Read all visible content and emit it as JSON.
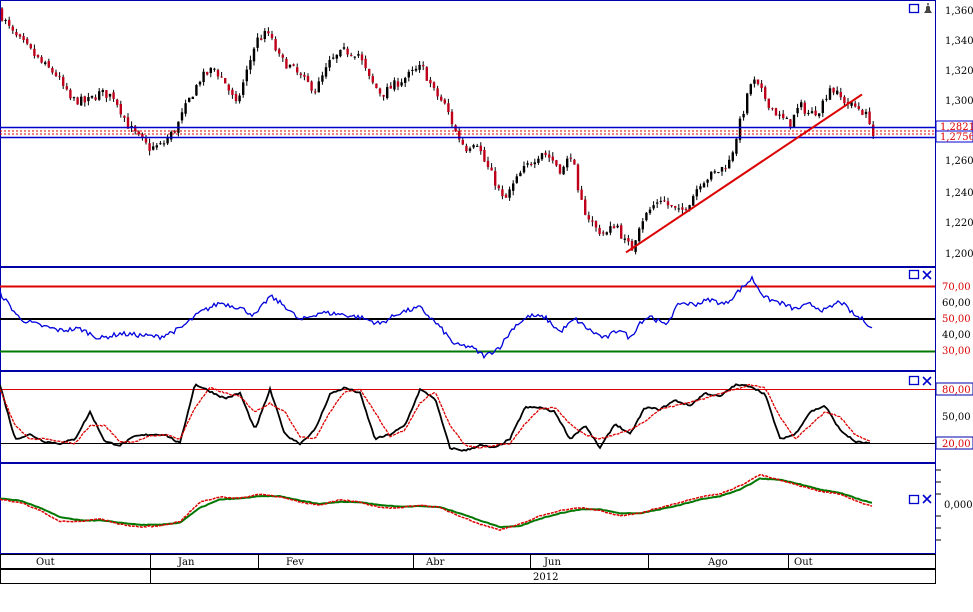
{
  "colors": {
    "bull": "#000000",
    "bear": "#c0001a",
    "blue_line": "#0000cc",
    "red_line": "#dd0000",
    "green_line": "#007700",
    "black_line": "#000000",
    "dotted_red": "#dd0000",
    "frame": "#0000aa",
    "grid_text": "#000000"
  },
  "panel_icons": {
    "window": "window-icon",
    "close": "close-icon",
    "bell": "bell-icon"
  },
  "price_panel": {
    "y_ticks": [
      "1,3600",
      "1,3400",
      "1,3200",
      "1,3000",
      "1,2600",
      "1,2400",
      "1,2200",
      "1,2000"
    ],
    "badge_upper": "1,28213",
    "badge_lower": "1,27561"
  },
  "rsi_panel": {
    "labels": [
      "70,00",
      "60,00",
      "50,00",
      "40,00",
      "30,00"
    ]
  },
  "stoch_panel": {
    "labels": [
      "80,00",
      "50,00",
      "20,00"
    ]
  },
  "macd_panel": {
    "labels": [
      "0,0000"
    ]
  },
  "time_axis": {
    "months": [
      "Out",
      "Jan",
      "Fev",
      "Abr",
      "Jun",
      "Ago",
      "Out"
    ],
    "year": "2012"
  },
  "chart_data": [
    {
      "type": "candlestick",
      "ylim": [
        1.195,
        1.365
      ],
      "x_tick_labels": [
        "Out",
        "Jan",
        "Fev",
        "Abr",
        "Jun",
        "Ago",
        "Out"
      ],
      "y_tick_labels": [
        "1,3600",
        "1,3400",
        "1,3200",
        "1,3000",
        "1,2600",
        "1,2400",
        "1,2200",
        "1,2000"
      ],
      "close_anchors": [
        [
          0,
          1.358
        ],
        [
          12,
          1.345
        ],
        [
          28,
          1.335
        ],
        [
          42,
          1.325
        ],
        [
          56,
          1.318
        ],
        [
          70,
          1.302
        ],
        [
          86,
          1.3
        ],
        [
          100,
          1.306
        ],
        [
          114,
          1.304
        ],
        [
          128,
          1.285
        ],
        [
          140,
          1.276
        ],
        [
          150,
          1.27
        ],
        [
          162,
          1.272
        ],
        [
          176,
          1.283
        ],
        [
          188,
          1.3
        ],
        [
          200,
          1.315
        ],
        [
          214,
          1.322
        ],
        [
          226,
          1.312
        ],
        [
          236,
          1.298
        ],
        [
          246,
          1.318
        ],
        [
          256,
          1.34
        ],
        [
          268,
          1.345
        ],
        [
          280,
          1.328
        ],
        [
          292,
          1.322
        ],
        [
          304,
          1.314
        ],
        [
          316,
          1.308
        ],
        [
          330,
          1.326
        ],
        [
          344,
          1.333
        ],
        [
          358,
          1.332
        ],
        [
          370,
          1.314
        ],
        [
          382,
          1.305
        ],
        [
          396,
          1.312
        ],
        [
          410,
          1.318
        ],
        [
          422,
          1.323
        ],
        [
          434,
          1.307
        ],
        [
          446,
          1.297
        ],
        [
          456,
          1.28
        ],
        [
          466,
          1.27
        ],
        [
          476,
          1.276
        ],
        [
          484,
          1.262
        ],
        [
          494,
          1.25
        ],
        [
          504,
          1.235
        ],
        [
          512,
          1.245
        ],
        [
          522,
          1.255
        ],
        [
          532,
          1.262
        ],
        [
          542,
          1.268
        ],
        [
          552,
          1.263
        ],
        [
          562,
          1.255
        ],
        [
          572,
          1.268
        ],
        [
          578,
          1.24
        ],
        [
          586,
          1.228
        ],
        [
          596,
          1.218
        ],
        [
          606,
          1.214
        ],
        [
          616,
          1.222
        ],
        [
          624,
          1.21
        ],
        [
          632,
          1.205
        ],
        [
          640,
          1.222
        ],
        [
          650,
          1.23
        ],
        [
          660,
          1.238
        ],
        [
          670,
          1.232
        ],
        [
          680,
          1.228
        ],
        [
          690,
          1.236
        ],
        [
          700,
          1.248
        ],
        [
          710,
          1.252
        ],
        [
          720,
          1.256
        ],
        [
          730,
          1.262
        ],
        [
          738,
          1.282
        ],
        [
          746,
          1.3
        ],
        [
          752,
          1.315
        ],
        [
          760,
          1.308
        ],
        [
          770,
          1.298
        ],
        [
          780,
          1.29
        ],
        [
          790,
          1.286
        ],
        [
          800,
          1.298
        ],
        [
          810,
          1.292
        ],
        [
          820,
          1.296
        ],
        [
          830,
          1.31
        ],
        [
          840,
          1.303
        ],
        [
          850,
          1.298
        ],
        [
          860,
          1.296
        ],
        [
          870,
          1.288
        ],
        [
          874,
          1.276
        ]
      ],
      "horizontal_levels": [
        1.28213,
        1.27561
      ],
      "trendlines": [
        {
          "from": [
            626,
            1.2025
          ],
          "to": [
            862,
            1.305
          ]
        }
      ]
    },
    {
      "type": "line",
      "ylim": [
        20,
        80
      ],
      "reference_levels": [
        70,
        50,
        30
      ],
      "series": [
        {
          "values_anchor_x": [
            0,
            20,
            40,
            60,
            80,
            100,
            120,
            140,
            160,
            180,
            200,
            220,
            240,
            255,
            270,
            285,
            300,
            320,
            340,
            360,
            380,
            400,
            420,
            440,
            455,
            470,
            485,
            500,
            515,
            530,
            545,
            560,
            575,
            590,
            605,
            620,
            630,
            640,
            650,
            665,
            680,
            695,
            710,
            725,
            740,
            752,
            765,
            780,
            795,
            810,
            825,
            840,
            855,
            865,
            872
          ],
          "values": [
            66,
            50,
            46,
            43,
            44,
            38,
            41,
            40,
            39,
            44,
            54,
            60,
            57,
            52,
            64,
            58,
            49,
            54,
            53,
            51,
            47,
            54,
            57,
            45,
            34,
            33,
            27,
            33,
            46,
            52,
            51,
            42,
            50,
            43,
            38,
            44,
            38,
            48,
            52,
            46,
            60,
            59,
            62,
            59,
            68,
            75,
            63,
            60,
            56,
            59,
            55,
            61,
            52,
            49,
            44
          ]
        }
      ]
    },
    {
      "type": "line",
      "ylim": [
        0,
        100
      ],
      "reference_levels": [
        80,
        20
      ],
      "series": [
        {
          "name": "",
          "values_anchor_x": [
            0,
            15,
            30,
            45,
            60,
            75,
            90,
            105,
            120,
            135,
            150,
            165,
            180,
            195,
            210,
            225,
            240,
            255,
            270,
            285,
            300,
            315,
            330,
            345,
            360,
            375,
            390,
            405,
            420,
            435,
            450,
            465,
            480,
            495,
            510,
            525,
            540,
            555,
            570,
            585,
            600,
            615,
            630,
            645,
            660,
            675,
            690,
            705,
            720,
            735,
            750,
            765,
            780,
            795,
            810,
            825,
            840,
            855,
            870
          ],
          "values": [
            85,
            25,
            30,
            22,
            20,
            25,
            55,
            22,
            18,
            28,
            30,
            30,
            20,
            86,
            78,
            70,
            76,
            35,
            80,
            30,
            20,
            35,
            75,
            82,
            76,
            25,
            30,
            40,
            80,
            70,
            15,
            12,
            18,
            15,
            25,
            60,
            60,
            55,
            25,
            40,
            15,
            42,
            30,
            60,
            58,
            68,
            62,
            76,
            72,
            85,
            84,
            75,
            25,
            30,
            55,
            62,
            35,
            22,
            20
          ]
        },
        {
          "name": "",
          "values_anchor_x": [
            0,
            15,
            30,
            45,
            60,
            75,
            90,
            105,
            120,
            135,
            150,
            165,
            180,
            195,
            210,
            225,
            240,
            255,
            270,
            285,
            300,
            315,
            330,
            345,
            360,
            375,
            390,
            405,
            420,
            435,
            450,
            465,
            480,
            495,
            510,
            525,
            540,
            555,
            570,
            585,
            600,
            615,
            630,
            645,
            660,
            675,
            690,
            705,
            720,
            735,
            750,
            765,
            780,
            795,
            810,
            825,
            840,
            855,
            870
          ],
          "values": [
            80,
            40,
            25,
            25,
            22,
            20,
            40,
            40,
            22,
            22,
            28,
            30,
            25,
            60,
            82,
            76,
            72,
            55,
            65,
            55,
            28,
            25,
            55,
            78,
            80,
            55,
            28,
            35,
            65,
            78,
            40,
            18,
            15,
            18,
            20,
            42,
            58,
            60,
            42,
            30,
            25,
            30,
            35,
            45,
            58,
            62,
            66,
            70,
            76,
            80,
            85,
            82,
            50,
            25,
            40,
            55,
            50,
            30,
            22
          ]
        }
      ]
    },
    {
      "type": "line",
      "ylim": [
        -1,
        1
      ],
      "reference_levels": [
        0
      ],
      "y_tick_labels": [
        "0,0000"
      ],
      "series": [
        {
          "name": "",
          "values_anchor_x": [
            0,
            20,
            40,
            60,
            80,
            100,
            120,
            140,
            160,
            180,
            200,
            220,
            240,
            260,
            280,
            300,
            320,
            340,
            360,
            380,
            400,
            420,
            440,
            460,
            480,
            500,
            520,
            540,
            560,
            580,
            600,
            620,
            640,
            660,
            680,
            700,
            720,
            740,
            760,
            780,
            800,
            820,
            840,
            860,
            872
          ],
          "values": [
            0.1,
            0.05,
            -0.1,
            -0.3,
            -0.3,
            -0.25,
            -0.35,
            -0.4,
            -0.38,
            -0.3,
            0.05,
            0.15,
            0.12,
            0.2,
            0.15,
            0.05,
            0.0,
            0.1,
            0.05,
            -0.05,
            -0.05,
            0.0,
            -0.05,
            -0.2,
            -0.35,
            -0.45,
            -0.35,
            -0.2,
            -0.1,
            -0.05,
            -0.1,
            -0.2,
            -0.15,
            -0.05,
            0.05,
            0.15,
            0.2,
            0.35,
            0.55,
            0.45,
            0.35,
            0.25,
            0.2,
            0.05,
            -0.02
          ]
        },
        {
          "name": "",
          "values_anchor_x": [
            0,
            20,
            40,
            60,
            80,
            100,
            120,
            140,
            160,
            180,
            200,
            220,
            240,
            260,
            280,
            300,
            320,
            340,
            360,
            380,
            400,
            420,
            440,
            460,
            480,
            500,
            520,
            540,
            560,
            580,
            600,
            620,
            640,
            660,
            680,
            700,
            720,
            740,
            760,
            780,
            800,
            820,
            840,
            860,
            872
          ],
          "values": [
            0.12,
            0.08,
            -0.05,
            -0.22,
            -0.28,
            -0.28,
            -0.32,
            -0.36,
            -0.36,
            -0.32,
            -0.05,
            0.1,
            0.12,
            0.16,
            0.16,
            0.08,
            0.02,
            0.06,
            0.05,
            0.0,
            -0.03,
            -0.02,
            -0.04,
            -0.15,
            -0.28,
            -0.4,
            -0.38,
            -0.25,
            -0.15,
            -0.08,
            -0.08,
            -0.15,
            -0.15,
            -0.08,
            0.0,
            0.1,
            0.16,
            0.28,
            0.48,
            0.46,
            0.38,
            0.28,
            0.22,
            0.1,
            0.04
          ]
        }
      ]
    }
  ]
}
